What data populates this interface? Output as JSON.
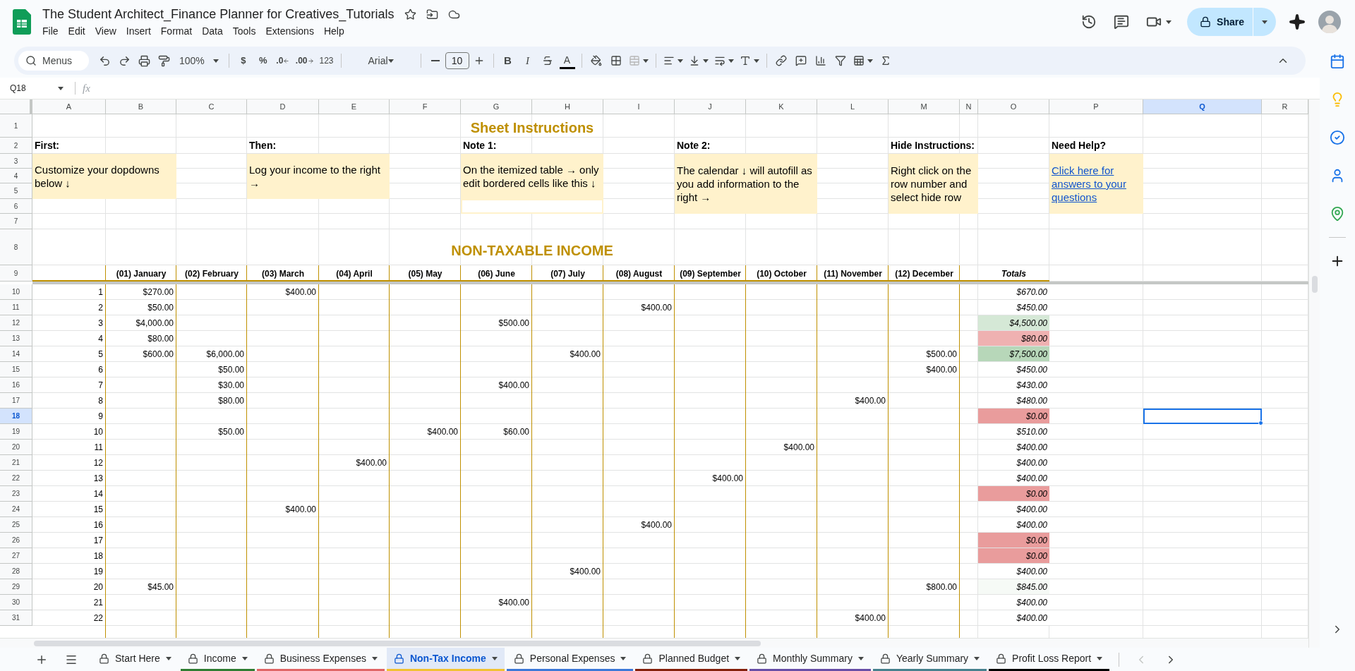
{
  "app": {
    "title": "The Student Architect_Finance Planner for Creatives_Tutorials",
    "menu": [
      "File",
      "Edit",
      "View",
      "Insert",
      "Format",
      "Data",
      "Tools",
      "Extensions",
      "Help"
    ],
    "share_label": "Share"
  },
  "toolbar": {
    "search_label": "Menus",
    "zoom": "100%",
    "currency": "$",
    "percent": "%",
    "decrease_decimals": ".0",
    "increase_decimals": ".00",
    "number_format": "123",
    "font": "Arial",
    "font_size": "10",
    "bold": "B",
    "italic": "I",
    "text_color": "A"
  },
  "formula_bar": {
    "cell_ref": "Q18",
    "fx": "fx"
  },
  "columns": [
    {
      "label": "A",
      "selected": false
    },
    {
      "label": "B",
      "selected": false
    },
    {
      "label": "C",
      "selected": false
    },
    {
      "label": "D",
      "selected": false
    },
    {
      "label": "E",
      "selected": false
    },
    {
      "label": "F",
      "selected": false
    },
    {
      "label": "G",
      "selected": false
    },
    {
      "label": "H",
      "selected": false
    },
    {
      "label": "I",
      "selected": false
    },
    {
      "label": "J",
      "selected": false
    },
    {
      "label": "K",
      "selected": false
    },
    {
      "label": "L",
      "selected": false
    },
    {
      "label": "M",
      "selected": false
    },
    {
      "label": "N",
      "selected": false
    },
    {
      "label": "O",
      "selected": false
    },
    {
      "label": "P",
      "selected": false
    },
    {
      "label": "Q",
      "selected": true
    },
    {
      "label": "R",
      "selected": false
    }
  ],
  "row_headers": [
    {
      "label": "1",
      "selected": false
    },
    {
      "label": "2",
      "selected": false
    },
    {
      "label": "3",
      "selected": false
    },
    {
      "label": "4",
      "selected": false
    },
    {
      "label": "5",
      "selected": false
    },
    {
      "label": "6",
      "selected": false
    },
    {
      "label": "7",
      "selected": false
    },
    {
      "label": "8",
      "selected": false
    },
    {
      "label": "9",
      "selected": false
    },
    {
      "label": "10",
      "selected": false
    },
    {
      "label": "11",
      "selected": false
    },
    {
      "label": "12",
      "selected": false
    },
    {
      "label": "13",
      "selected": false
    },
    {
      "label": "14",
      "selected": false
    },
    {
      "label": "15",
      "selected": false
    },
    {
      "label": "16",
      "selected": false
    },
    {
      "label": "17",
      "selected": false
    },
    {
      "label": "18",
      "selected": true
    },
    {
      "label": "19",
      "selected": false
    },
    {
      "label": "20",
      "selected": false
    },
    {
      "label": "21",
      "selected": false
    },
    {
      "label": "22",
      "selected": false
    },
    {
      "label": "23",
      "selected": false
    },
    {
      "label": "24",
      "selected": false
    },
    {
      "label": "25",
      "selected": false
    },
    {
      "label": "26",
      "selected": false
    },
    {
      "label": "27",
      "selected": false
    },
    {
      "label": "28",
      "selected": false
    },
    {
      "label": "29",
      "selected": false
    },
    {
      "label": "30",
      "selected": false
    },
    {
      "label": "31",
      "selected": false
    }
  ],
  "instructions": {
    "title": "Sheet Instructions",
    "notes": [
      {
        "heading": "First:",
        "body": "Customize your dopdowns below ↓",
        "kind": "text"
      },
      {
        "heading": "Then:",
        "body": "Log your income to the right  →",
        "kind": "text"
      },
      {
        "heading": "Note 1:",
        "body": "On the itemized table  → only edit bordered cells like this ↓",
        "kind": "example"
      },
      {
        "heading": "Note 2:",
        "body": "The calendar ↓ will autofill as you add information to the right  →",
        "kind": "text"
      },
      {
        "heading": "Hide Instructions:",
        "body": "Right click on the row number and select hide row",
        "kind": "text"
      },
      {
        "heading": "Need Help?",
        "body": "Click here for answers to your questions",
        "kind": "link"
      }
    ]
  },
  "table": {
    "title": "NON-TAXABLE INCOME",
    "months": [
      "(01) January",
      "(02) February",
      "(03) March",
      "(04) April",
      "(05) May",
      "(06) June",
      "(07) July",
      "(08) August",
      "(09) September",
      "(10) October",
      "(11) November",
      "(12) December"
    ],
    "totals_label": "Totals",
    "rows": [
      {
        "number": "1",
        "cells": [
          {
            "kind": "amount",
            "text": "$270.00"
          },
          {
            "kind": "empty"
          },
          {
            "kind": "amount",
            "text": "$400.00"
          },
          {
            "kind": "empty"
          },
          {
            "kind": "empty"
          },
          {
            "kind": "empty"
          },
          {
            "kind": "empty"
          },
          {
            "kind": "empty"
          },
          {
            "kind": "empty"
          },
          {
            "kind": "empty"
          },
          {
            "kind": "empty"
          },
          {
            "kind": "empty"
          }
        ],
        "total": "$670.00",
        "color": "#ffffff"
      },
      {
        "number": "2",
        "cells": [
          {
            "kind": "amount",
            "text": "$50.00"
          },
          {
            "kind": "empty"
          },
          {
            "kind": "empty"
          },
          {
            "kind": "empty"
          },
          {
            "kind": "empty"
          },
          {
            "kind": "empty"
          },
          {
            "kind": "empty"
          },
          {
            "kind": "amount",
            "text": "$400.00"
          },
          {
            "kind": "empty"
          },
          {
            "kind": "empty"
          },
          {
            "kind": "empty"
          },
          {
            "kind": "empty"
          }
        ],
        "total": "$450.00",
        "color": "#ffffff"
      },
      {
        "number": "3",
        "cells": [
          {
            "kind": "amount",
            "text": "$4,000.00"
          },
          {
            "kind": "empty"
          },
          {
            "kind": "empty"
          },
          {
            "kind": "empty"
          },
          {
            "kind": "empty"
          },
          {
            "kind": "amount",
            "text": "$500.00"
          },
          {
            "kind": "empty"
          },
          {
            "kind": "empty"
          },
          {
            "kind": "empty"
          },
          {
            "kind": "empty"
          },
          {
            "kind": "empty"
          },
          {
            "kind": "empty"
          }
        ],
        "total": "$4,500.00",
        "color": "#d5e8d6"
      },
      {
        "number": "4",
        "cells": [
          {
            "kind": "amount",
            "text": "$80.00"
          },
          {
            "kind": "empty"
          },
          {
            "kind": "empty"
          },
          {
            "kind": "empty"
          },
          {
            "kind": "empty"
          },
          {
            "kind": "empty"
          },
          {
            "kind": "empty"
          },
          {
            "kind": "empty"
          },
          {
            "kind": "empty"
          },
          {
            "kind": "empty"
          },
          {
            "kind": "empty"
          },
          {
            "kind": "empty"
          }
        ],
        "total": "$80.00",
        "color": "#efb1b1"
      },
      {
        "number": "5",
        "cells": [
          {
            "kind": "amount",
            "text": "$600.00"
          },
          {
            "kind": "amount",
            "text": "$6,000.00"
          },
          {
            "kind": "empty"
          },
          {
            "kind": "empty"
          },
          {
            "kind": "empty"
          },
          {
            "kind": "empty"
          },
          {
            "kind": "amount",
            "text": "$400.00"
          },
          {
            "kind": "empty"
          },
          {
            "kind": "empty"
          },
          {
            "kind": "empty"
          },
          {
            "kind": "empty"
          },
          {
            "kind": "amount",
            "text": "$500.00"
          }
        ],
        "total": "$7,500.00",
        "color": "#b7d7b9"
      },
      {
        "number": "6",
        "cells": [
          {
            "kind": "empty"
          },
          {
            "kind": "amount",
            "text": "$50.00"
          },
          {
            "kind": "empty"
          },
          {
            "kind": "empty"
          },
          {
            "kind": "empty"
          },
          {
            "kind": "empty"
          },
          {
            "kind": "empty"
          },
          {
            "kind": "empty"
          },
          {
            "kind": "empty"
          },
          {
            "kind": "empty"
          },
          {
            "kind": "empty"
          },
          {
            "kind": "amount",
            "text": "$400.00"
          }
        ],
        "total": "$450.00",
        "color": "#ffffff"
      },
      {
        "number": "7",
        "cells": [
          {
            "kind": "empty"
          },
          {
            "kind": "amount",
            "text": "$30.00"
          },
          {
            "kind": "empty"
          },
          {
            "kind": "empty"
          },
          {
            "kind": "empty"
          },
          {
            "kind": "amount",
            "text": "$400.00"
          },
          {
            "kind": "empty"
          },
          {
            "kind": "empty"
          },
          {
            "kind": "empty"
          },
          {
            "kind": "empty"
          },
          {
            "kind": "empty"
          },
          {
            "kind": "empty"
          }
        ],
        "total": "$430.00",
        "color": "#ffffff"
      },
      {
        "number": "8",
        "cells": [
          {
            "kind": "empty"
          },
          {
            "kind": "amount",
            "text": "$80.00"
          },
          {
            "kind": "empty"
          },
          {
            "kind": "empty"
          },
          {
            "kind": "empty"
          },
          {
            "kind": "empty"
          },
          {
            "kind": "empty"
          },
          {
            "kind": "empty"
          },
          {
            "kind": "empty"
          },
          {
            "kind": "empty"
          },
          {
            "kind": "amount",
            "text": "$400.00"
          },
          {
            "kind": "empty"
          }
        ],
        "total": "$480.00",
        "color": "#ffffff"
      },
      {
        "number": "9",
        "cells": [
          {
            "kind": "empty"
          },
          {
            "kind": "empty"
          },
          {
            "kind": "empty"
          },
          {
            "kind": "empty"
          },
          {
            "kind": "empty"
          },
          {
            "kind": "empty"
          },
          {
            "kind": "empty"
          },
          {
            "kind": "empty"
          },
          {
            "kind": "empty"
          },
          {
            "kind": "empty"
          },
          {
            "kind": "empty"
          },
          {
            "kind": "empty"
          }
        ],
        "total": "$0.00",
        "color": "#e99c9c"
      },
      {
        "number": "10",
        "cells": [
          {
            "kind": "empty"
          },
          {
            "kind": "amount",
            "text": "$50.00"
          },
          {
            "kind": "empty"
          },
          {
            "kind": "empty"
          },
          {
            "kind": "amount",
            "text": "$400.00"
          },
          {
            "kind": "amount",
            "text": "$60.00"
          },
          {
            "kind": "empty"
          },
          {
            "kind": "empty"
          },
          {
            "kind": "empty"
          },
          {
            "kind": "empty"
          },
          {
            "kind": "empty"
          },
          {
            "kind": "empty"
          }
        ],
        "total": "$510.00",
        "color": "#ffffff"
      },
      {
        "number": "11",
        "cells": [
          {
            "kind": "empty"
          },
          {
            "kind": "empty"
          },
          {
            "kind": "empty"
          },
          {
            "kind": "empty"
          },
          {
            "kind": "empty"
          },
          {
            "kind": "empty"
          },
          {
            "kind": "empty"
          },
          {
            "kind": "empty"
          },
          {
            "kind": "empty"
          },
          {
            "kind": "amount",
            "text": "$400.00"
          },
          {
            "kind": "empty"
          },
          {
            "kind": "empty"
          }
        ],
        "total": "$400.00",
        "color": "#ffffff"
      },
      {
        "number": "12",
        "cells": [
          {
            "kind": "empty"
          },
          {
            "kind": "empty"
          },
          {
            "kind": "empty"
          },
          {
            "kind": "amount",
            "text": "$400.00"
          },
          {
            "kind": "empty"
          },
          {
            "kind": "empty"
          },
          {
            "kind": "empty"
          },
          {
            "kind": "empty"
          },
          {
            "kind": "empty"
          },
          {
            "kind": "empty"
          },
          {
            "kind": "empty"
          },
          {
            "kind": "empty"
          }
        ],
        "total": "$400.00",
        "color": "#ffffff"
      },
      {
        "number": "13",
        "cells": [
          {
            "kind": "empty"
          },
          {
            "kind": "empty"
          },
          {
            "kind": "empty"
          },
          {
            "kind": "empty"
          },
          {
            "kind": "empty"
          },
          {
            "kind": "empty"
          },
          {
            "kind": "empty"
          },
          {
            "kind": "empty"
          },
          {
            "kind": "amount",
            "text": "$400.00"
          },
          {
            "kind": "empty"
          },
          {
            "kind": "empty"
          },
          {
            "kind": "empty"
          }
        ],
        "total": "$400.00",
        "color": "#ffffff"
      },
      {
        "number": "14",
        "cells": [
          {
            "kind": "empty"
          },
          {
            "kind": "empty"
          },
          {
            "kind": "empty"
          },
          {
            "kind": "empty"
          },
          {
            "kind": "empty"
          },
          {
            "kind": "empty"
          },
          {
            "kind": "empty"
          },
          {
            "kind": "empty"
          },
          {
            "kind": "empty"
          },
          {
            "kind": "empty"
          },
          {
            "kind": "empty"
          },
          {
            "kind": "empty"
          }
        ],
        "total": "$0.00",
        "color": "#e99c9c"
      },
      {
        "number": "15",
        "cells": [
          {
            "kind": "empty"
          },
          {
            "kind": "empty"
          },
          {
            "kind": "amount",
            "text": "$400.00"
          },
          {
            "kind": "empty"
          },
          {
            "kind": "empty"
          },
          {
            "kind": "empty"
          },
          {
            "kind": "empty"
          },
          {
            "kind": "empty"
          },
          {
            "kind": "empty"
          },
          {
            "kind": "empty"
          },
          {
            "kind": "empty"
          },
          {
            "kind": "empty"
          }
        ],
        "total": "$400.00",
        "color": "#ffffff"
      },
      {
        "number": "16",
        "cells": [
          {
            "kind": "empty"
          },
          {
            "kind": "empty"
          },
          {
            "kind": "empty"
          },
          {
            "kind": "empty"
          },
          {
            "kind": "empty"
          },
          {
            "kind": "empty"
          },
          {
            "kind": "empty"
          },
          {
            "kind": "amount",
            "text": "$400.00"
          },
          {
            "kind": "empty"
          },
          {
            "kind": "empty"
          },
          {
            "kind": "empty"
          },
          {
            "kind": "empty"
          }
        ],
        "total": "$400.00",
        "color": "#ffffff"
      },
      {
        "number": "17",
        "cells": [
          {
            "kind": "empty"
          },
          {
            "kind": "empty"
          },
          {
            "kind": "empty"
          },
          {
            "kind": "empty"
          },
          {
            "kind": "empty"
          },
          {
            "kind": "empty"
          },
          {
            "kind": "empty"
          },
          {
            "kind": "empty"
          },
          {
            "kind": "empty"
          },
          {
            "kind": "empty"
          },
          {
            "kind": "empty"
          },
          {
            "kind": "empty"
          }
        ],
        "total": "$0.00",
        "color": "#e99c9c"
      },
      {
        "number": "18",
        "cells": [
          {
            "kind": "empty"
          },
          {
            "kind": "empty"
          },
          {
            "kind": "empty"
          },
          {
            "kind": "empty"
          },
          {
            "kind": "empty"
          },
          {
            "kind": "empty"
          },
          {
            "kind": "empty"
          },
          {
            "kind": "empty"
          },
          {
            "kind": "empty"
          },
          {
            "kind": "empty"
          },
          {
            "kind": "empty"
          },
          {
            "kind": "empty"
          }
        ],
        "total": "$0.00",
        "color": "#e99c9c"
      },
      {
        "number": "19",
        "cells": [
          {
            "kind": "empty"
          },
          {
            "kind": "empty"
          },
          {
            "kind": "empty"
          },
          {
            "kind": "empty"
          },
          {
            "kind": "empty"
          },
          {
            "kind": "empty"
          },
          {
            "kind": "amount",
            "text": "$400.00"
          },
          {
            "kind": "empty"
          },
          {
            "kind": "empty"
          },
          {
            "kind": "empty"
          },
          {
            "kind": "empty"
          },
          {
            "kind": "empty"
          }
        ],
        "total": "$400.00",
        "color": "#ffffff"
      },
      {
        "number": "20",
        "cells": [
          {
            "kind": "amount",
            "text": "$45.00"
          },
          {
            "kind": "empty"
          },
          {
            "kind": "empty"
          },
          {
            "kind": "empty"
          },
          {
            "kind": "empty"
          },
          {
            "kind": "empty"
          },
          {
            "kind": "empty"
          },
          {
            "kind": "empty"
          },
          {
            "kind": "empty"
          },
          {
            "kind": "empty"
          },
          {
            "kind": "empty"
          },
          {
            "kind": "amount",
            "text": "$800.00"
          }
        ],
        "total": "$845.00",
        "color": "#f6faf6"
      },
      {
        "number": "21",
        "cells": [
          {
            "kind": "empty"
          },
          {
            "kind": "empty"
          },
          {
            "kind": "empty"
          },
          {
            "kind": "empty"
          },
          {
            "kind": "empty"
          },
          {
            "kind": "amount",
            "text": "$400.00"
          },
          {
            "kind": "empty"
          },
          {
            "kind": "empty"
          },
          {
            "kind": "empty"
          },
          {
            "kind": "empty"
          },
          {
            "kind": "empty"
          },
          {
            "kind": "empty"
          }
        ],
        "total": "$400.00",
        "color": "#ffffff"
      },
      {
        "number": "22",
        "cells": [
          {
            "kind": "empty"
          },
          {
            "kind": "empty"
          },
          {
            "kind": "empty"
          },
          {
            "kind": "empty"
          },
          {
            "kind": "empty"
          },
          {
            "kind": "empty"
          },
          {
            "kind": "empty"
          },
          {
            "kind": "empty"
          },
          {
            "kind": "empty"
          },
          {
            "kind": "empty"
          },
          {
            "kind": "amount",
            "text": "$400.00"
          },
          {
            "kind": "empty"
          }
        ],
        "total": "$400.00",
        "color": "#ffffff"
      }
    ]
  },
  "sheet_tabs": [
    {
      "label": "Start Here",
      "selected": false
    },
    {
      "label": "Income",
      "selected": false,
      "color": "#2e7d32"
    },
    {
      "label": "Business Expenses",
      "selected": false,
      "color": "#e06666"
    },
    {
      "label": "Non-Tax Income",
      "selected": true,
      "color": "#f1c232"
    },
    {
      "label": "Personal Expenses",
      "selected": false,
      "color": "#3c78d8"
    },
    {
      "label": "Planned Budget",
      "selected": false,
      "color": "#85200c"
    },
    {
      "label": "Monthly Summary",
      "selected": false,
      "color": "#674ea7"
    },
    {
      "label": "Yearly Summary",
      "selected": false,
      "color": "#45818e"
    },
    {
      "label": "Profit Loss Report",
      "selected": false,
      "color": "#000000"
    }
  ]
}
